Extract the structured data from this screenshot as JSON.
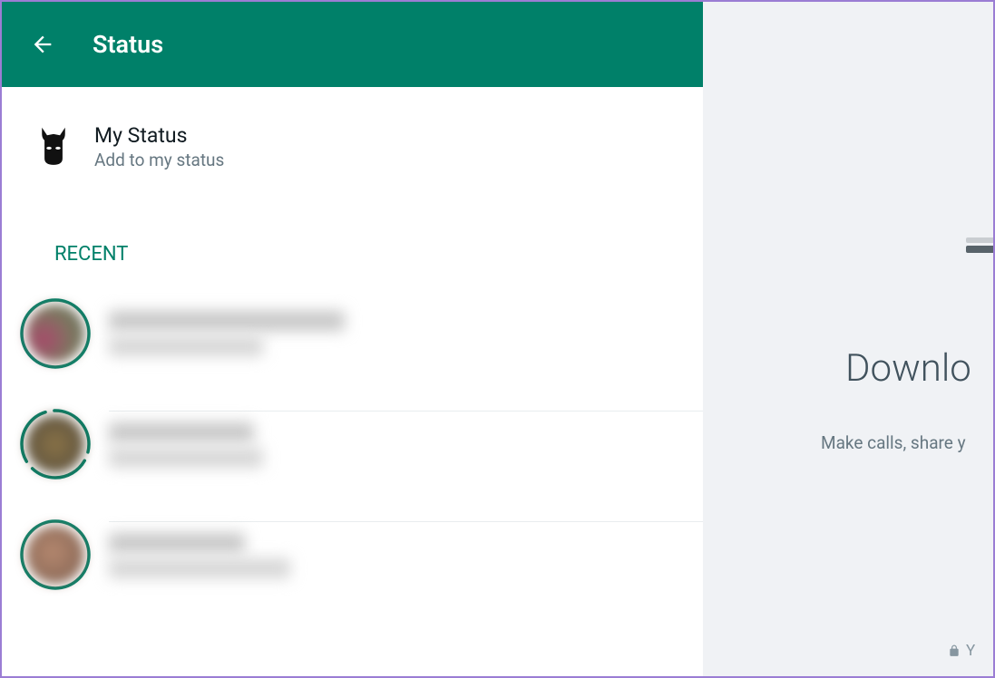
{
  "header": {
    "title": "Status"
  },
  "myStatus": {
    "title": "My Status",
    "subtitle": "Add to my status",
    "icon": "batman-mask-icon"
  },
  "sections": {
    "recentLabel": "RECENT"
  },
  "recent": [
    {
      "ringSegments": 1,
      "avatarIcon": "contact-avatar"
    },
    {
      "ringSegments": 3,
      "avatarIcon": "contact-avatar"
    },
    {
      "ringSegments": 1,
      "avatarIcon": "contact-avatar"
    }
  ],
  "rightPanel": {
    "title": "Downlo",
    "subtitle": "Make calls, share y",
    "footer": "Y",
    "footerIcon": "lock-icon"
  },
  "colors": {
    "brand": "#008069",
    "border": "#9b7dd4",
    "rightBg": "#f0f2f5"
  }
}
